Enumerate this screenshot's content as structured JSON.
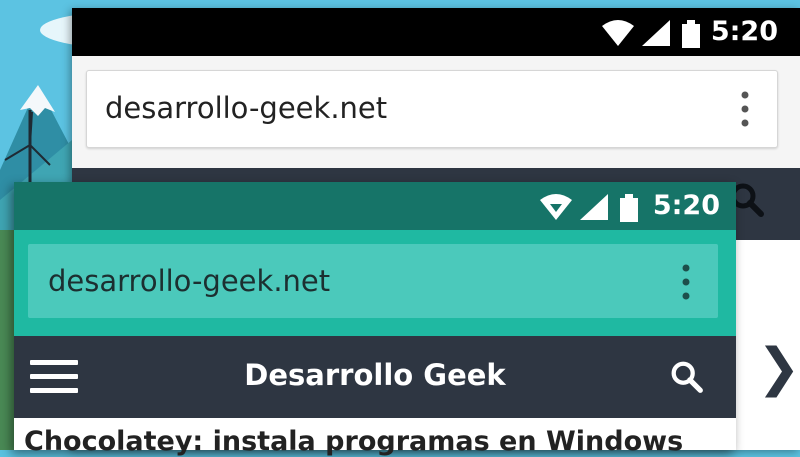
{
  "back_window": {
    "status_bar": {
      "time": "5:20",
      "icons": [
        "wifi-icon",
        "signal-icon",
        "battery-icon"
      ]
    },
    "address_bar": {
      "url": "desarrollo-geek.net"
    }
  },
  "front_window": {
    "status_bar": {
      "time": "5:20",
      "icons": [
        "wifi-icon",
        "signal-icon",
        "battery-icon"
      ]
    },
    "address_bar": {
      "url": "desarrollo-geek.net"
    },
    "site_header": {
      "title": "Desarrollo Geek"
    },
    "article": {
      "title": "Chocolatey: instala programas en Windows"
    }
  },
  "colors": {
    "front_status": "#167468",
    "front_toolbar": "#1fb9a2",
    "front_url_field": "#4bc9bb",
    "navbar": "#2e3642",
    "back_status": "#000000"
  }
}
